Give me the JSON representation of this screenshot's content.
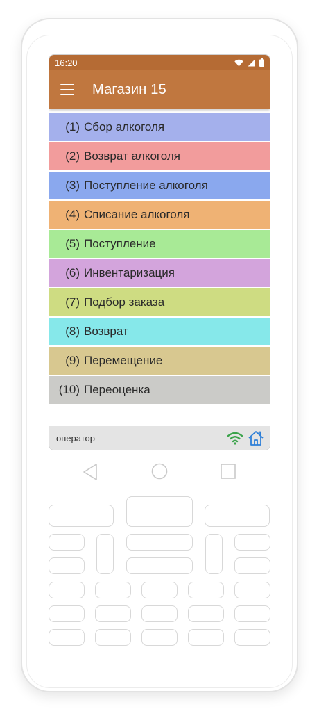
{
  "status_bar": {
    "time": "16:20"
  },
  "app_bar": {
    "title": "Магазин 15"
  },
  "menu": {
    "items": [
      {
        "num": "(1)",
        "label": "Сбор алкоголя",
        "color": "#a4b0ec"
      },
      {
        "num": "(2)",
        "label": "Возврат алкоголя",
        "color": "#f29c9c"
      },
      {
        "num": "(3)",
        "label": "Поступление алкоголя",
        "color": "#8aa8ee"
      },
      {
        "num": "(4)",
        "label": "Списание алкоголя",
        "color": "#efb274"
      },
      {
        "num": "(5)",
        "label": "Поступление",
        "color": "#a8ea96"
      },
      {
        "num": "(6)",
        "label": "Инвентаризация",
        "color": "#d3a4dc"
      },
      {
        "num": "(7)",
        "label": "Подбор заказа",
        "color": "#cedc82"
      },
      {
        "num": "(8)",
        "label": "Возврат",
        "color": "#86e8ea"
      },
      {
        "num": "(9)",
        "label": "Перемещение",
        "color": "#d8c890"
      },
      {
        "num": "(10)",
        "label": "Переоценка",
        "color": "#cbcbc8"
      }
    ]
  },
  "bottom_bar": {
    "user": "оператор",
    "wifi_color": "#3aa34a",
    "home_color": "#2d7fd8"
  },
  "icons": [
    "hamburger-menu-icon",
    "wifi-signal-icon",
    "cell-signal-icon",
    "battery-icon",
    "wifi-icon",
    "home-icon",
    "back-icon",
    "home-circle-icon",
    "recents-square-icon"
  ],
  "theme": {
    "status_bar": "#b56b34",
    "app_bar": "#c0773f"
  }
}
